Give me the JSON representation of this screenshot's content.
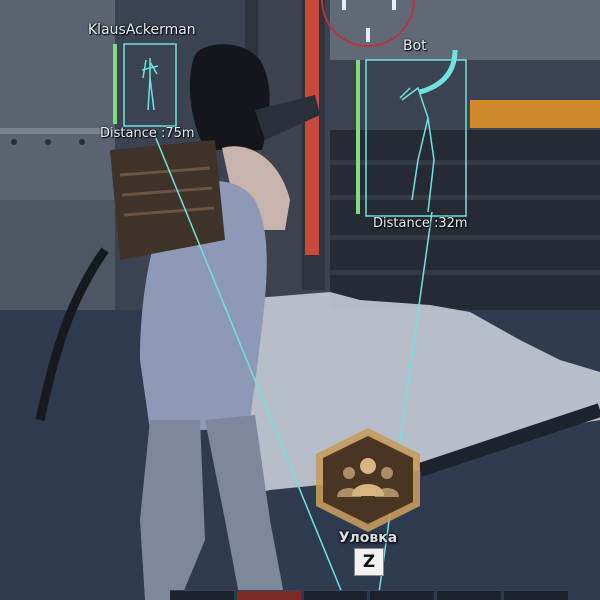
{
  "players": [
    {
      "name": "KlausAckerman",
      "distance": "Distance :75m",
      "health": 1.0
    },
    {
      "name": "Bot",
      "distance": "Distance :32m",
      "health": 1.0
    }
  ],
  "ability": {
    "label": "Уловка",
    "key": "Z",
    "icon": "group-people-icon"
  },
  "colors": {
    "esp_box": "#6fe3e0",
    "health": "#7ce07a",
    "ability_gold": "#c89a5c"
  }
}
